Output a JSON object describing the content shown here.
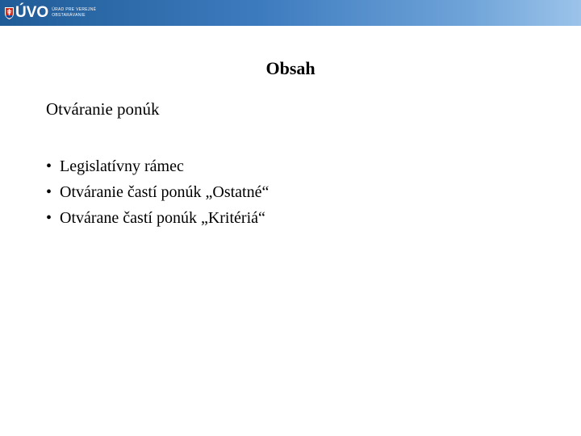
{
  "header": {
    "logo_text": "ÚVO",
    "logo_subtitle_line1": "ÚRAD PRE VEREJNÉ",
    "logo_subtitle_line2": "OBSTARÁVANIE",
    "crest_icon": "slovak-crest-icon",
    "gradient_colors": [
      "#1f5c97",
      "#9cc3ea"
    ]
  },
  "slide": {
    "title": "Obsah",
    "section_heading": "Otváranie ponúk",
    "bullet_symbol": "•",
    "bullets": [
      "Legislatívny rámec",
      "Otváranie častí ponúk „Ostatné“",
      "Otvárane častí ponúk „Kritériá“"
    ]
  }
}
